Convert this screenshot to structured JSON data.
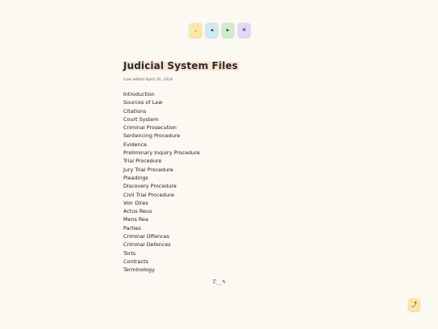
{
  "toolbar": {
    "buttons": [
      {
        "icon": "font-size-icon",
        "glyph": "،",
        "color": "#fbe7a3"
      },
      {
        "icon": "previous-icon",
        "glyph": "◂",
        "color": "#cfe7f6"
      },
      {
        "icon": "next-icon",
        "glyph": "▸",
        "color": "#cdeccf"
      },
      {
        "icon": "theme-icon",
        "glyph": "☀",
        "color": "#e3d6f7"
      }
    ]
  },
  "page": {
    "title": "Judicial System Files",
    "updated": "Last edited April 26, 2024"
  },
  "toc": [
    "Introduction",
    "Sources of Law",
    "Citations",
    "Court System",
    "Criminal Prosecution",
    "Sentencing Procedure",
    "Evidence",
    "Preliminary Inquiry Procedure",
    "Trial Procedure",
    "Jury Trial Procedure",
    "Pleadings",
    "Discovery Procedure",
    "Civil Trial Procedure",
    "Voir Dires",
    "Actus Reus",
    "Mens Rea",
    "Parties",
    "Criminal Offences",
    "Criminal Defences",
    "Torts",
    "Contracts",
    "Terminology"
  ],
  "footer": {
    "signature": "T.__✎"
  },
  "back_to_top": {
    "icon": "arrow-up-icon",
    "glyph": "⤴"
  }
}
